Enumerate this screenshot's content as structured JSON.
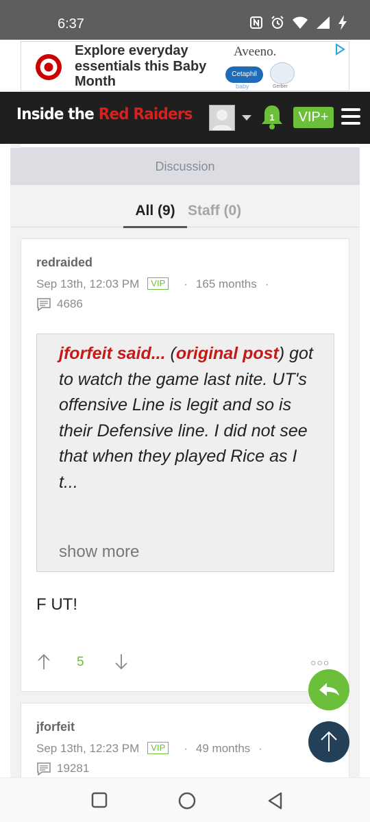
{
  "status_bar": {
    "time": "6:37",
    "icons": [
      "nfc-icon",
      "alarm-icon",
      "wifi-icon",
      "signal-icon",
      "charging-icon"
    ]
  },
  "ad": {
    "text": "Explore everyday essentials this Baby Month",
    "brand": "Aveeno.",
    "cetaphil": "Cetaphil",
    "baby": "baby",
    "gerber": "Gerber",
    "brand_color": "#cc0000"
  },
  "header": {
    "title_white": "Inside the",
    "title_red": "Red Raiders",
    "notification_count": "1",
    "vip_label": "VIP+",
    "accent_color": "#6cbf3a"
  },
  "discussion": {
    "heading": "Discussion",
    "tabs": [
      {
        "label": "All (9)",
        "active": true
      },
      {
        "label": "Staff (0)",
        "active": false
      }
    ]
  },
  "posts": [
    {
      "author": "redraided",
      "date": "Sep 13th, 12:03 PM",
      "badge": "VIP",
      "tenure": "165 months",
      "post_count": "4686",
      "quote": {
        "author": "jforfeit said...",
        "open_paren": " (",
        "link": "original post",
        "close_paren": ")",
        "text": "got to watch the game last nite. UT's offensive Line is legit and so is their Defensive line. I did not see that when they played Rice as I t...",
        "show_more": "show more"
      },
      "body": "F UT!",
      "votes": "5"
    },
    {
      "author": "jforfeit",
      "date": "Sep 13th, 12:23 PM",
      "badge": "VIP",
      "tenure": "49 months",
      "post_count": "19281"
    }
  ]
}
